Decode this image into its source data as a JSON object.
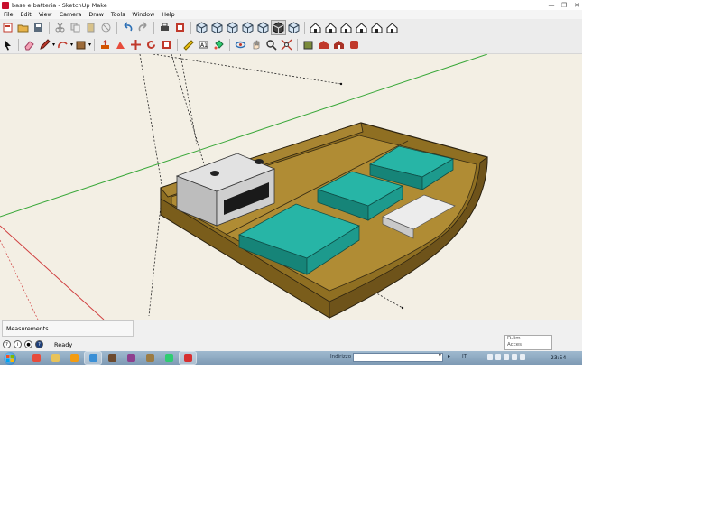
{
  "window": {
    "title": "base e batteria - SketchUp Make",
    "controls": [
      "—",
      "❐",
      "✕"
    ]
  },
  "menu": [
    "File",
    "Edit",
    "View",
    "Camera",
    "Draw",
    "Tools",
    "Window",
    "Help"
  ],
  "toolbar1": [
    {
      "name": "new-file-icon",
      "glyph": "new"
    },
    {
      "name": "open-file-icon",
      "glyph": "open"
    },
    {
      "name": "save-icon",
      "glyph": "save"
    },
    {
      "name": "cut-icon",
      "glyph": "cut"
    },
    {
      "name": "copy-icon",
      "glyph": "copy"
    },
    {
      "name": "paste-icon",
      "glyph": "paste"
    },
    {
      "name": "erase-icon",
      "glyph": "erase"
    },
    {
      "name": "undo-icon",
      "glyph": "undo"
    },
    {
      "name": "redo-icon",
      "glyph": "redo"
    },
    {
      "name": "print-icon",
      "glyph": "print"
    },
    {
      "name": "model-info-icon",
      "glyph": "info"
    },
    {
      "name": "xray-style-icon",
      "glyph": "cube"
    },
    {
      "name": "back-edges-style-icon",
      "glyph": "cube"
    },
    {
      "name": "wireframe-style-icon",
      "glyph": "cube"
    },
    {
      "name": "hidden-line-style-icon",
      "glyph": "cube"
    },
    {
      "name": "shaded-style-icon",
      "glyph": "cube"
    },
    {
      "name": "shaded-textures-style-icon",
      "glyph": "cube-active"
    },
    {
      "name": "monochrome-style-icon",
      "glyph": "cube"
    },
    {
      "name": "iso-view-icon",
      "glyph": "house"
    },
    {
      "name": "top-view-icon",
      "glyph": "house"
    },
    {
      "name": "front-view-icon",
      "glyph": "house"
    },
    {
      "name": "right-view-icon",
      "glyph": "house"
    },
    {
      "name": "back-view-icon",
      "glyph": "house"
    },
    {
      "name": "left-view-icon",
      "glyph": "house"
    }
  ],
  "toolbar2": [
    {
      "name": "select-tool-icon",
      "glyph": "arrow"
    },
    {
      "name": "eraser-tool-icon",
      "glyph": "eraser"
    },
    {
      "name": "line-tool-icon",
      "glyph": "pencil"
    },
    {
      "name": "arc-tool-icon",
      "glyph": "arc"
    },
    {
      "name": "rectangle-tool-icon",
      "glyph": "rect"
    },
    {
      "name": "push-pull-tool-icon",
      "glyph": "push"
    },
    {
      "name": "follow-me-tool-icon",
      "glyph": "follow"
    },
    {
      "name": "move-tool-icon",
      "glyph": "move"
    },
    {
      "name": "rotate-tool-icon",
      "glyph": "rotate"
    },
    {
      "name": "scale-tool-icon",
      "glyph": "scale"
    },
    {
      "name": "tape-measure-tool-icon",
      "glyph": "tape"
    },
    {
      "name": "text-tool-icon",
      "glyph": "text"
    },
    {
      "name": "paint-bucket-tool-icon",
      "glyph": "paint"
    },
    {
      "name": "orbit-tool-icon",
      "glyph": "orbit"
    },
    {
      "name": "pan-tool-icon",
      "glyph": "pan"
    },
    {
      "name": "zoom-tool-icon",
      "glyph": "zoom"
    },
    {
      "name": "zoom-extents-tool-icon",
      "glyph": "extents"
    },
    {
      "name": "warehouse-icon",
      "glyph": "warehouse"
    },
    {
      "name": "share-model-icon",
      "glyph": "share"
    },
    {
      "name": "get-models-icon",
      "glyph": "get"
    },
    {
      "name": "extension-icon",
      "glyph": "ext"
    }
  ],
  "measurements": {
    "label": "Measurements"
  },
  "status": {
    "text": "Ready"
  },
  "dim_box": {
    "line1": "D-lim",
    "line2": "Acces"
  },
  "taskbar": {
    "address_label": "Indirizzo",
    "address_value": "",
    "go_glyph": "▸",
    "language": "IT",
    "clock": "23:54",
    "apps": [
      {
        "name": "taskbar-chrome",
        "color": "#e74c3c"
      },
      {
        "name": "taskbar-explorer",
        "color": "#e8c35a"
      },
      {
        "name": "taskbar-media-player",
        "color": "#f39c12"
      },
      {
        "name": "taskbar-ie",
        "color": "#3a8fd6"
      },
      {
        "name": "taskbar-app-5",
        "color": "#6c4a2e"
      },
      {
        "name": "taskbar-winrar",
        "color": "#8e3f8e"
      },
      {
        "name": "taskbar-app-7",
        "color": "#9b7b43"
      },
      {
        "name": "taskbar-app-8",
        "color": "#2ecc71"
      },
      {
        "name": "taskbar-sketchup",
        "color": "#d63031"
      }
    ]
  },
  "colors": {
    "viewport_bg": "#f3efe4",
    "hull_wood": "#9c7b2b",
    "seat_teal": "#1ea89a",
    "battery_grey": "#d4d4d4",
    "axis_green": "#3aa83a",
    "axis_red": "#d04040"
  }
}
